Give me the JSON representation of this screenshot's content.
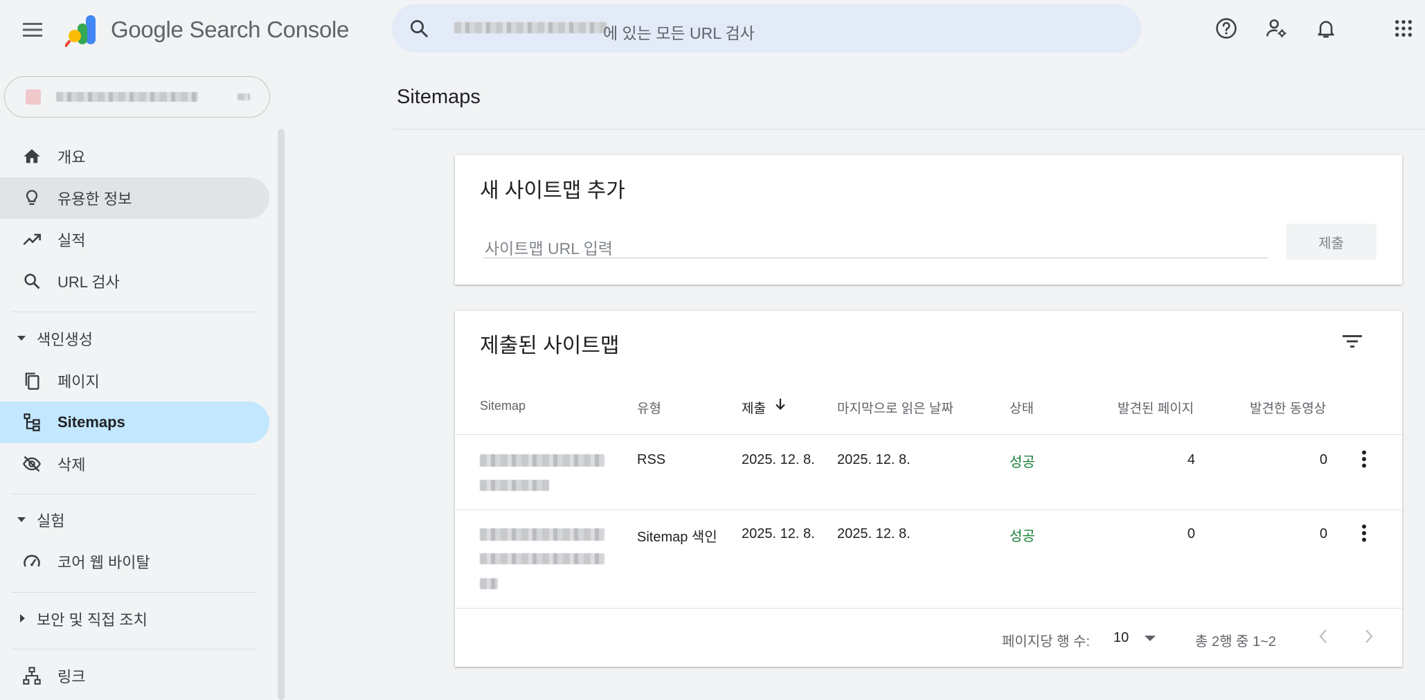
{
  "header": {
    "app_title": "Google Search Console",
    "search_placeholder": "에 있는 모든 URL 검사"
  },
  "sidebar": {
    "property_selector": "",
    "items": [
      {
        "label": "개요"
      },
      {
        "label": "유용한 정보"
      },
      {
        "label": "실적"
      },
      {
        "label": "URL 검사"
      }
    ],
    "sections": {
      "indexing": "색인생성",
      "experiments": "실험",
      "security": "보안 및 직접 조치"
    },
    "indexing_items": [
      {
        "label": "페이지"
      },
      {
        "label": "Sitemaps"
      },
      {
        "label": "삭제"
      }
    ],
    "experiment_items": [
      {
        "label": "코어 웹 바이탈"
      }
    ],
    "links_item": "링크"
  },
  "main": {
    "page_title": "Sitemaps",
    "add_card": {
      "title": "새 사이트맵 추가",
      "input_placeholder": "사이트맵 URL 입력",
      "submit_label": "제출"
    },
    "submitted_card": {
      "title": "제출된 사이트맵",
      "columns": [
        "Sitemap",
        "유형",
        "제출",
        "마지막으로 읽은 날짜",
        "상태",
        "발견된 페이지",
        "발견한 동영상"
      ],
      "rows": [
        {
          "type": "RSS",
          "submitted": "2025. 12. 8.",
          "last_read": "2025. 12. 8.",
          "status": "성공",
          "pages": "4",
          "videos": "0"
        },
        {
          "type": "Sitemap 색인",
          "submitted": "2025. 12. 8.",
          "last_read": "2025. 12. 8.",
          "status": "성공",
          "pages": "0",
          "videos": "0"
        }
      ],
      "pagination": {
        "rows_per_page_label": "페이지당 행 수:",
        "rows_per_page_value": "10",
        "range_text": "총 2행 중 1~2"
      }
    }
  },
  "colors": {
    "status_success": "#188038",
    "active_nav": "#c2e7ff",
    "search_bg": "#e3ebf9"
  }
}
